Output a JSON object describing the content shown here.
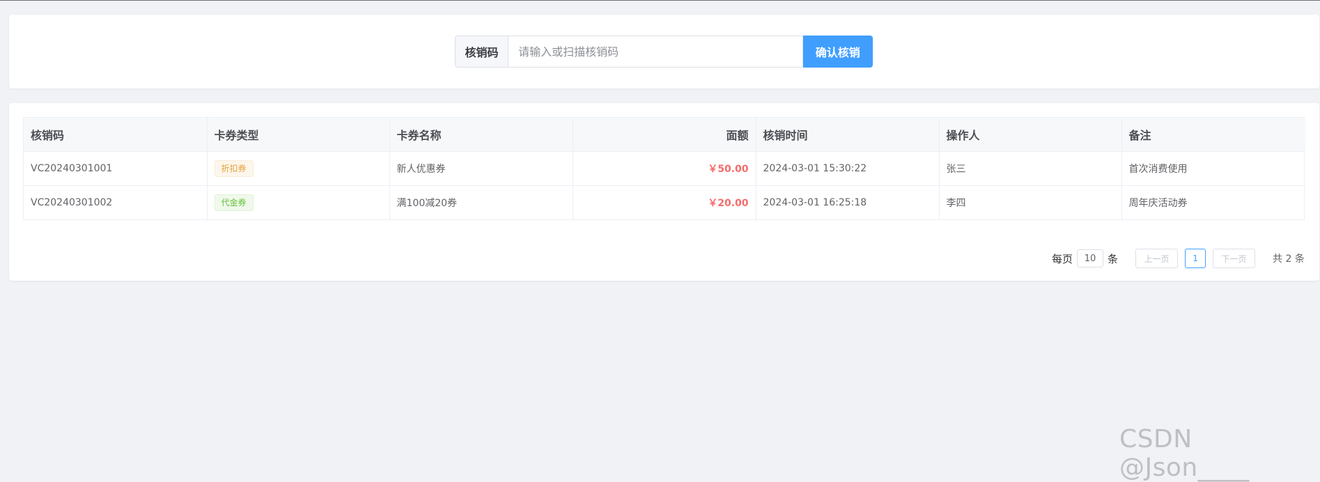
{
  "search": {
    "label": "核销码",
    "placeholder": "请输入或扫描核销码",
    "value": "",
    "confirm_label": "确认核销"
  },
  "table": {
    "columns": [
      "核销码",
      "卡券类型",
      "卡券名称",
      "面额",
      "核销时间",
      "操作人",
      "备注"
    ],
    "rows": [
      {
        "code": "VC20240301001",
        "type": "折扣券",
        "type_style": "warning",
        "name": "新人优惠券",
        "amount": "￥50.00",
        "time": "2024-03-01 15:30:22",
        "operator": "张三",
        "remark": "首次消费使用"
      },
      {
        "code": "VC20240301002",
        "type": "代金券",
        "type_style": "success",
        "name": "满100减20券",
        "amount": "￥20.00",
        "time": "2024-03-01 16:25:18",
        "operator": "李四",
        "remark": "周年庆活动券"
      }
    ]
  },
  "pagination": {
    "per_page_label": "每页",
    "page_size": "10",
    "unit_label": "条",
    "prev_label": "上一页",
    "current_page": "1",
    "next_label": "下一页",
    "total_label": "共 2 条"
  },
  "watermark": "CSDN @Json____",
  "colors": {
    "primary": "#409eff",
    "amount": "#f56c6c",
    "tag_warning": "#e6a23c",
    "tag_success": "#67c23a",
    "background": "#f0f2f5"
  }
}
